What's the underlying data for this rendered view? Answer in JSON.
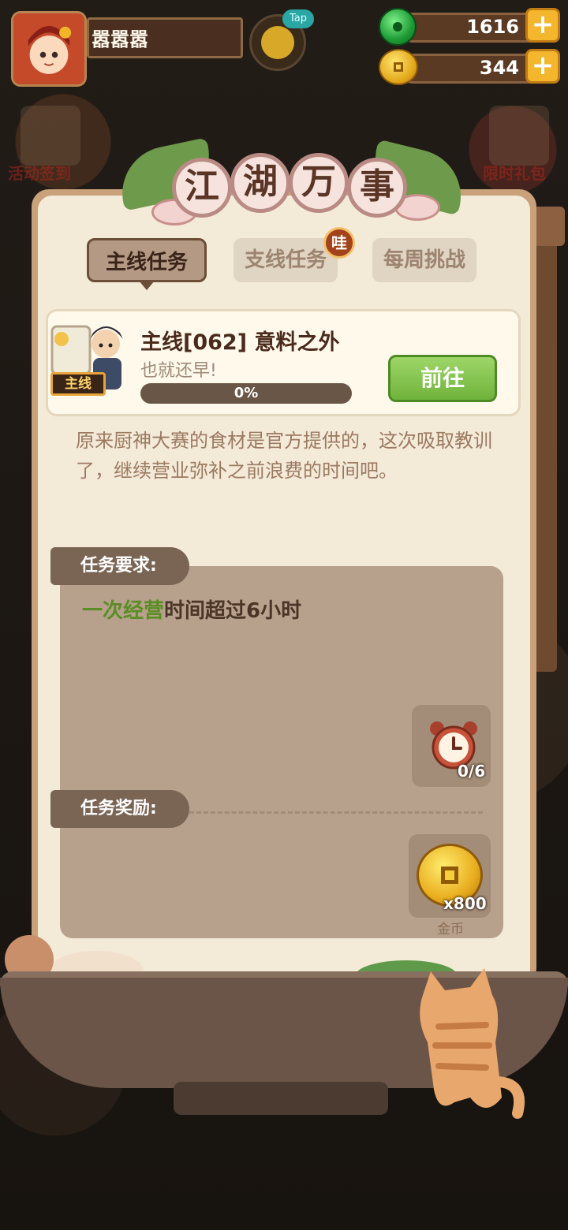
{
  "player": {
    "name": "嚣嚣嚣"
  },
  "tap_badge": "Tap",
  "resources": {
    "jade": "1616",
    "coins": "344"
  },
  "side_menu": {
    "left_top": "活动签到",
    "right_top": "限时礼包"
  },
  "panel": {
    "title_chars": [
      "江",
      "湖",
      "万",
      "事"
    ],
    "tabs": [
      {
        "label": "主线任务",
        "active": true
      },
      {
        "label": "支线任务",
        "badge": "哇"
      },
      {
        "label": "每周挑战"
      }
    ]
  },
  "quest": {
    "tag": "主线",
    "title": "主线[062] 意料之外",
    "subtitle": "也就还早!",
    "progress": 0,
    "progress_label": "0%",
    "go_button": "前往",
    "description": "原来厨神大赛的食材是官方提供的，这次吸取教训了，继续营业弥补之前浪费的时间吧。"
  },
  "requirement": {
    "label": "任务要求:",
    "highlight": "一次经营",
    "rest": "时间超过6小时",
    "counter": "0/6",
    "icon": "alarm-clock-icon"
  },
  "reward": {
    "label": "任务奖励:",
    "amount": "x800",
    "name": "金币",
    "icon": "gold-coin-icon"
  },
  "colors": {
    "highlight_green": "#5a8d24",
    "go_button_green": "#6fb33b",
    "accent_gold": "#f3b62d"
  }
}
